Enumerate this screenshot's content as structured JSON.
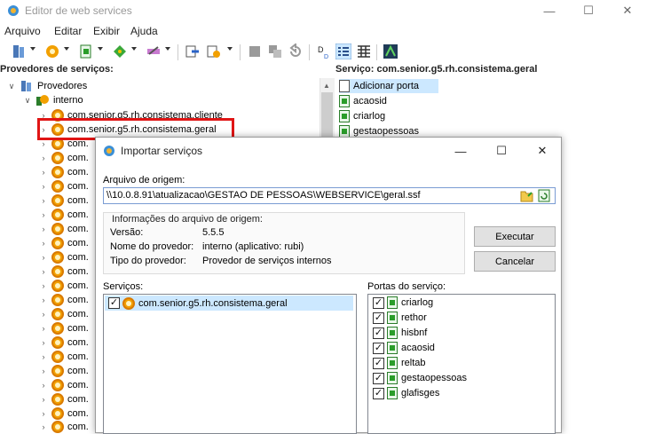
{
  "window": {
    "title": "Editor de web services"
  },
  "menu": {
    "items": [
      "Arquivo",
      "Editar",
      "Exibir",
      "Ajuda"
    ]
  },
  "left_panel": {
    "header": "Provedores de serviços:",
    "root": "Provedores",
    "group": "interno",
    "items": [
      "com.senior.g5.rh.consistema.cliente",
      "com.senior.g5.rh.consistema.geral"
    ],
    "truncated_label": "com."
  },
  "right_panel": {
    "header": "Serviço: com.senior.g5.rh.consistema.geral",
    "add_port": "Adicionar porta",
    "ports": [
      "acaosid",
      "criarlog",
      "gestaopessoas"
    ]
  },
  "dialog": {
    "title": "Importar serviços",
    "origin_label": "Arquivo de origem:",
    "origin_value": "\\\\10.0.8.91\\atualizacao\\GESTAO DE PESSOAS\\WEBSERVICE\\geral.ssf",
    "info_title": "Informações do arquivo de origem:",
    "version_label": "Versão:",
    "version_value": "5.5.5",
    "provider_name_label": "Nome do provedor:",
    "provider_name_value": "interno (aplicativo: rubi)",
    "provider_type_label": "Tipo do provedor:",
    "provider_type_value": "Provedor de serviços internos",
    "execute_button": "Executar",
    "cancel_button": "Cancelar",
    "services_label": "Serviços:",
    "service": "com.senior.g5.rh.consistema.geral",
    "ports_label": "Portas do serviço:",
    "ports": [
      "criarlog",
      "rethor",
      "hisbnf",
      "acaosid",
      "reltab",
      "gestaopessoas",
      "glafisges"
    ]
  },
  "colors": {
    "highlight": "#e01515",
    "selection": "#cce8ff"
  }
}
